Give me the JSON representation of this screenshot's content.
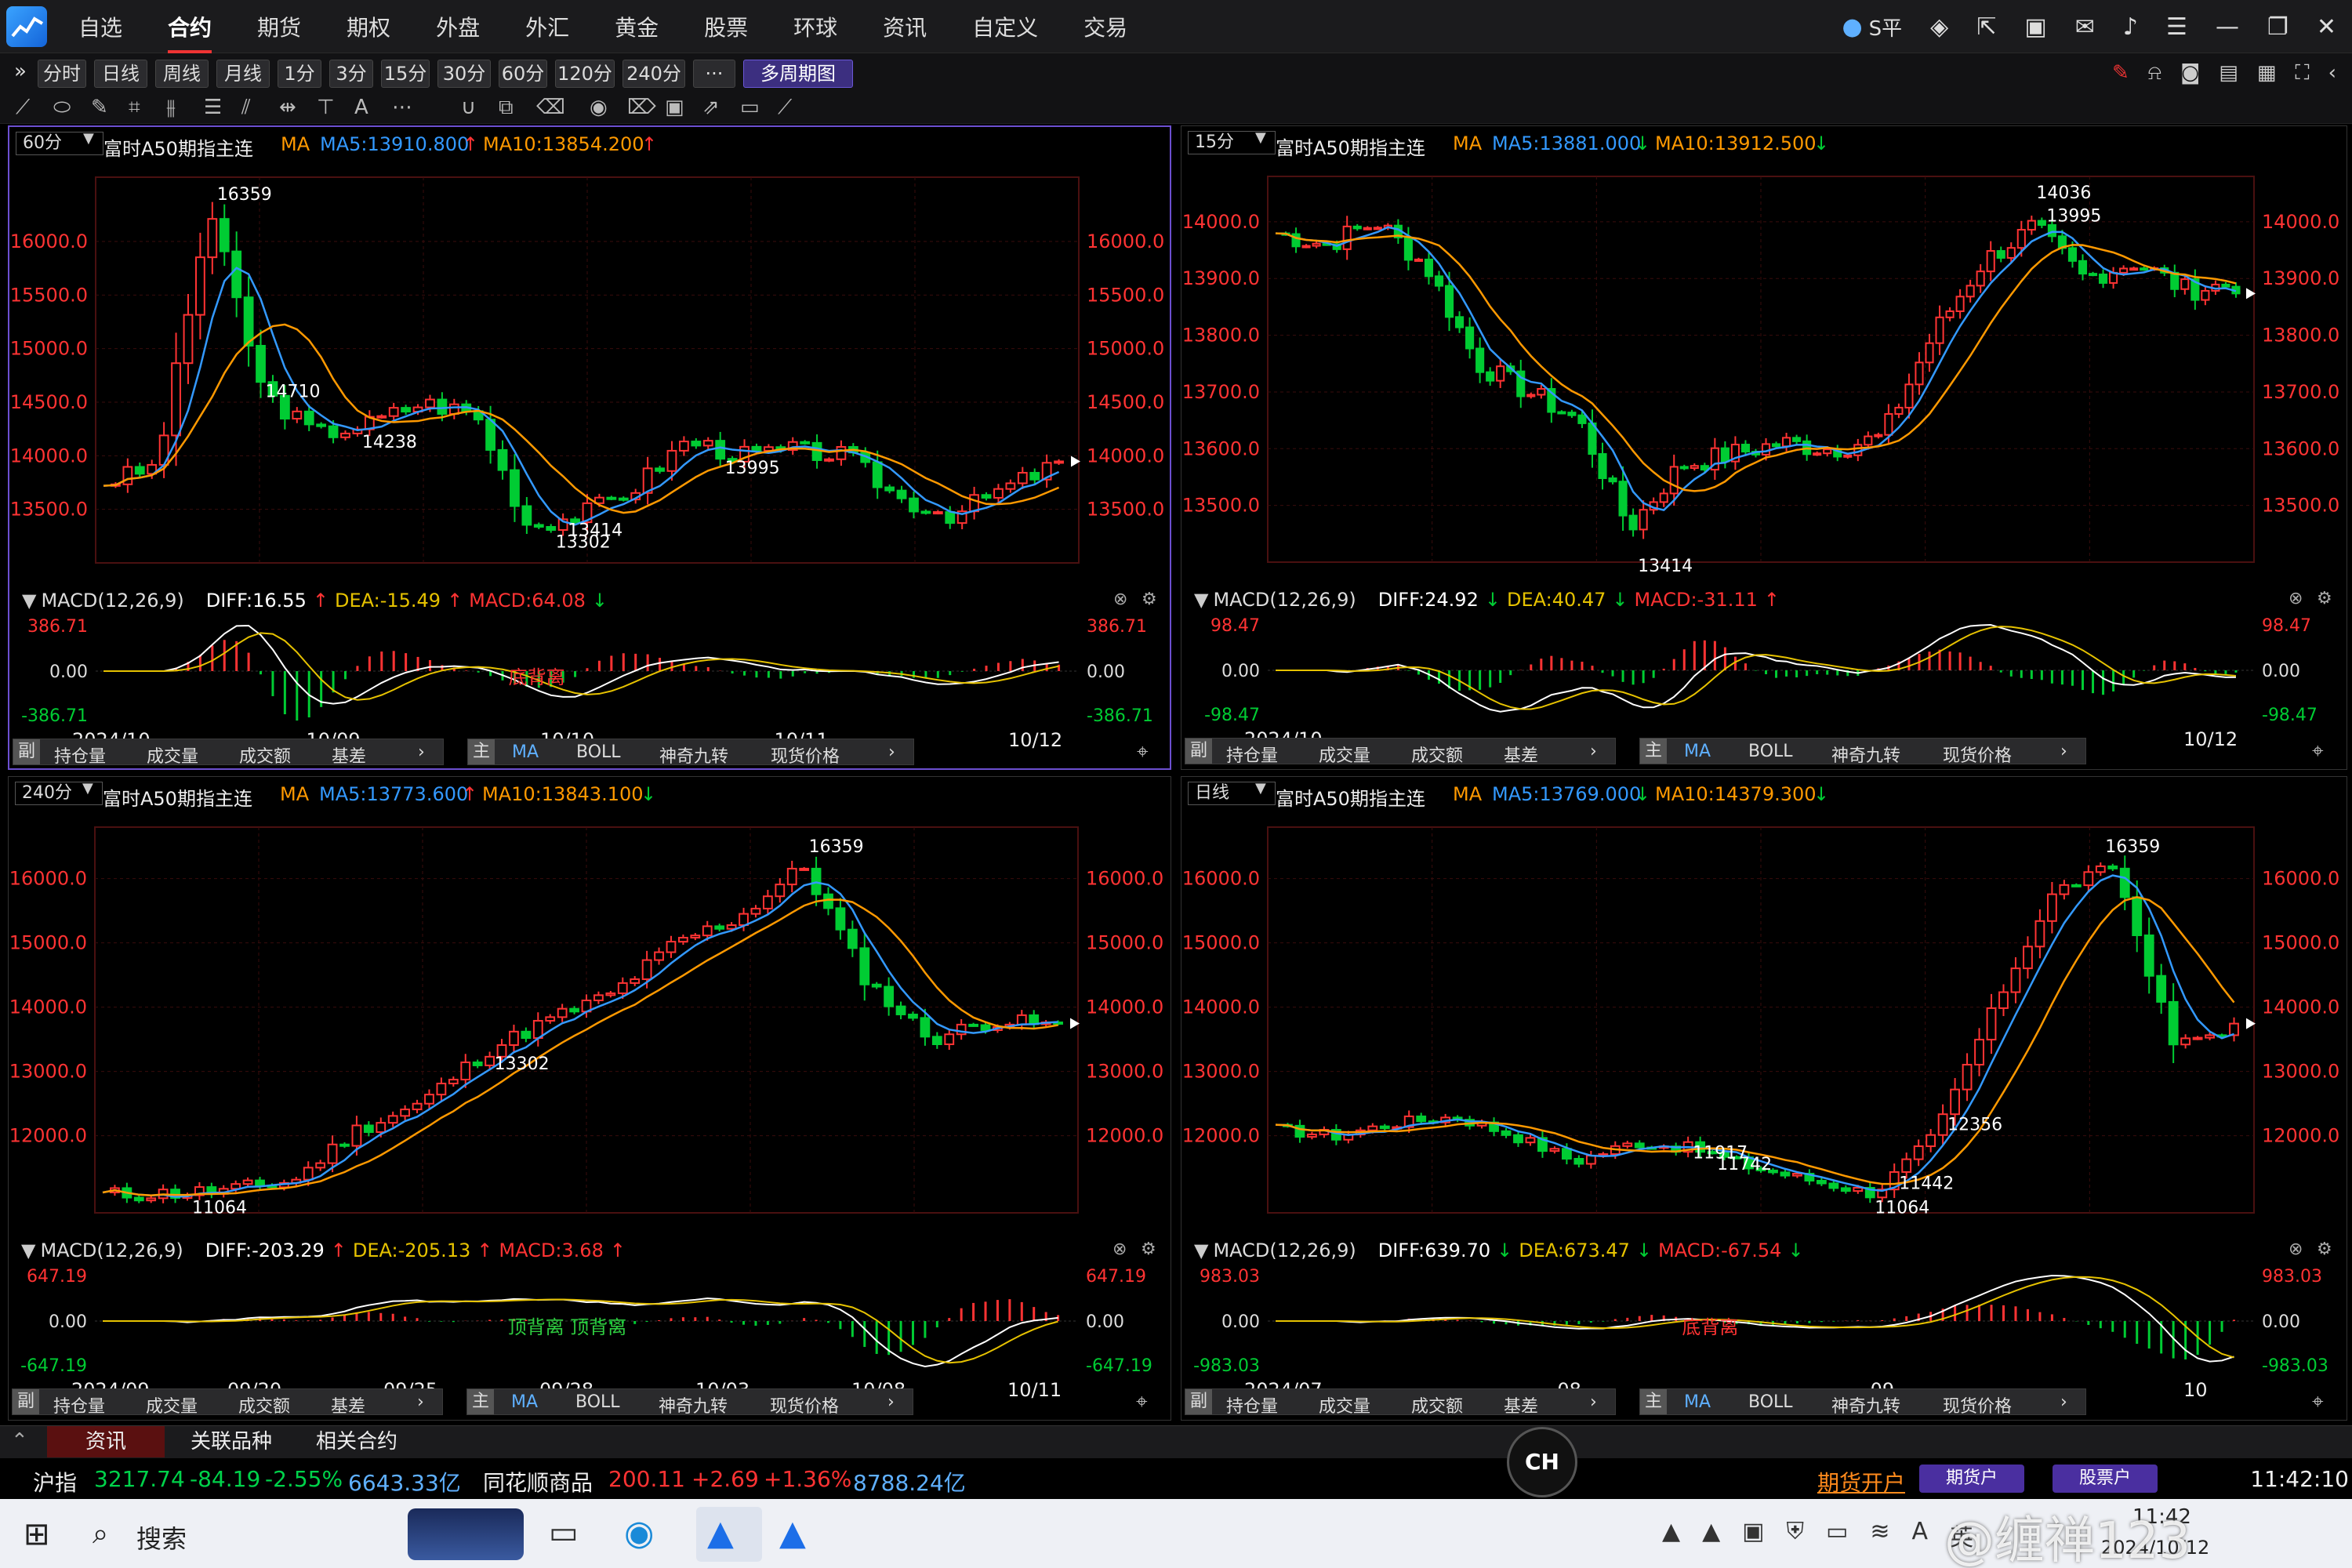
{
  "nav": [
    "自选",
    "合约",
    "期货",
    "期权",
    "外盘",
    "外汇",
    "黄金",
    "股票",
    "环球",
    "资讯",
    "自定义",
    "交易"
  ],
  "nav_active": 1,
  "account": "S平",
  "periods": [
    "分时",
    "日线",
    "周线",
    "月线",
    "1分",
    "3分",
    "15分",
    "30分",
    "60分",
    "120分",
    "240分",
    "···",
    "多周期图"
  ],
  "periods_active": 12,
  "colors": {
    "up": "#ff3333",
    "down": "#00cc33",
    "ma5": "#3399ff",
    "ma10": "#ff9900",
    "diff": "#ffffff",
    "dea": "#e6c200",
    "accent": "#6c4fd0"
  },
  "panels": [
    {
      "id": "60",
      "period": "60分",
      "name": "富时A50期指主连",
      "ma": "MA",
      "ma5": "MA5:13910.800",
      "ma10": "MA10:13854.200",
      "ma5dir": "↑",
      "ma10dir": "↑",
      "yticks": [
        "16000.0",
        "15500.0",
        "15000.0",
        "14500.0",
        "14000.0",
        "13500.0"
      ],
      "ymin": 13000,
      "ymax": 16600,
      "tickvals": [
        16000,
        15500,
        15000,
        14500,
        14000,
        13500
      ],
      "macd": {
        "label": "MACD(12,26,9)",
        "diff": "DIFF:16.55",
        "dea": "DEA:-15.49",
        "macd": "MACD:64.08",
        "diffdir": "↑",
        "deadir": "↑",
        "macddir": "↓",
        "top": "386.71",
        "zero": "0.00",
        "bot": "-386.71",
        "note": "底背离"
      },
      "dates": [
        "2024/10",
        "10/09",
        "10/10",
        "10/11",
        "10/12"
      ],
      "annotations": [
        "16359",
        "14710",
        "14238",
        "13995",
        "13302",
        "13414"
      ]
    },
    {
      "id": "15",
      "period": "15分",
      "name": "富时A50期指主连",
      "ma": "MA",
      "ma5": "MA5:13881.000",
      "ma10": "MA10:13912.500",
      "ma5dir": "↓",
      "ma10dir": "↓",
      "yticks": [
        "14000.0",
        "13900.0",
        "13800.0",
        "13700.0",
        "13600.0",
        "13500.0"
      ],
      "ymin": 13400,
      "ymax": 14080,
      "tickvals": [
        14000,
        13900,
        13800,
        13700,
        13600,
        13500
      ],
      "macd": {
        "label": "MACD(12,26,9)",
        "diff": "DIFF:24.92",
        "dea": "DEA:40.47",
        "macd": "MACD:-31.11",
        "diffdir": "↓",
        "deadir": "↓",
        "macddir": "↑",
        "top": "98.47",
        "zero": "0.00",
        "bot": "-98.47",
        "note": ""
      },
      "dates": [
        "2024/10",
        "10/12"
      ],
      "annotations": [
        "14036",
        "13995",
        "13414"
      ]
    },
    {
      "id": "240",
      "period": "240分",
      "name": "富时A50期指主连",
      "ma": "MA",
      "ma5": "MA5:13773.600",
      "ma10": "MA10:13843.100",
      "ma5dir": "↑",
      "ma10dir": "↓",
      "yticks": [
        "16000.0",
        "15000.0",
        "14000.0",
        "13000.0",
        "12000.0"
      ],
      "ymin": 10800,
      "ymax": 16800,
      "tickvals": [
        16000,
        15000,
        14000,
        13000,
        12000
      ],
      "macd": {
        "label": "MACD(12,26,9)",
        "diff": "DIFF:-203.29",
        "dea": "DEA:-205.13",
        "macd": "MACD:3.68",
        "diffdir": "↑",
        "deadir": "↑",
        "macddir": "↑",
        "top": "647.19",
        "zero": "0.00",
        "bot": "-647.19",
        "note": "顶背离 顶背离"
      },
      "dates": [
        "2024/09",
        "09/20",
        "09/25",
        "09/28",
        "10/03",
        "10/08",
        "10/11"
      ],
      "annotations": [
        "16359",
        "13302",
        "11064"
      ]
    },
    {
      "id": "day",
      "period": "日线",
      "name": "富时A50期指主连",
      "ma": "MA",
      "ma5": "MA5:13769.000",
      "ma10": "MA10:14379.300",
      "ma5dir": "↓",
      "ma10dir": "↓",
      "yticks": [
        "16000.0",
        "15000.0",
        "14000.0",
        "13000.0",
        "12000.0"
      ],
      "ymin": 10800,
      "ymax": 16800,
      "tickvals": [
        16000,
        15000,
        14000,
        13000,
        12000
      ],
      "macd": {
        "label": "MACD(12,26,9)",
        "diff": "DIFF:639.70",
        "dea": "DEA:673.47",
        "macd": "MACD:-67.54",
        "diffdir": "↓",
        "deadir": "↓",
        "macddir": "↓",
        "top": "983.03",
        "zero": "0.00",
        "bot": "-983.03",
        "note": "底背离"
      },
      "dates": [
        "2024/07",
        "08",
        "09",
        "10"
      ],
      "annotations": [
        "16359",
        "12356",
        "11917",
        "11742",
        "11442",
        "11064"
      ]
    }
  ],
  "foot": {
    "fu": "副",
    "items1": [
      "持仓量",
      "成交量",
      "成交额",
      "基差"
    ],
    "zhu": "主",
    "items2": [
      "MA",
      "BOLL",
      "神奇九转",
      "现货价格"
    ]
  },
  "bottomtabs": [
    "资讯",
    "关联品种",
    "相关合约"
  ],
  "ticker": {
    "name": "沪指",
    "price": "3217.74",
    "chg": "-84.19",
    "pct": "-2.55%",
    "amt": "6643.33亿",
    "name2": "同花顺商品",
    "price2": "200.11",
    "chg2": "+2.69",
    "pct2": "+1.36%",
    "amt2": "8788.24亿",
    "open1": "期货开户",
    "open2": "期货户",
    "open3": "股票户"
  },
  "taskbar": {
    "search": "搜索",
    "time": "11:42",
    "date": "2024/10/12",
    "clock": "11:42:10",
    "watermark": "@缠禅123",
    "ime": "CH"
  }
}
